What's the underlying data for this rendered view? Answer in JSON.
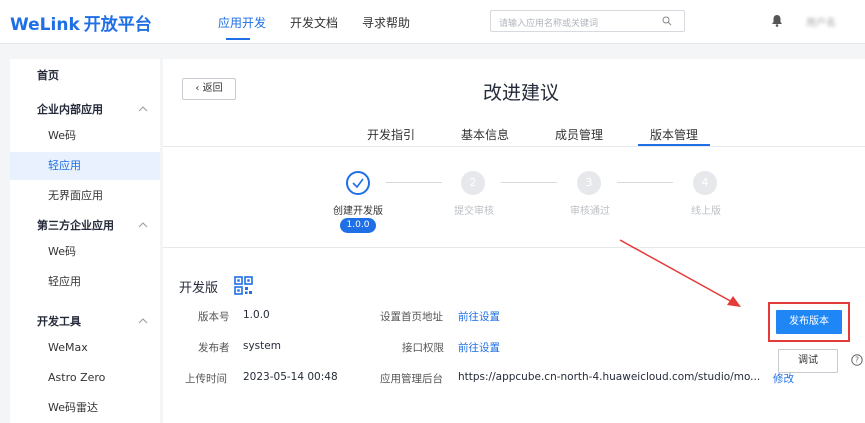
{
  "header": {
    "logo": "WeLink",
    "logo_suffix": "开放平台",
    "nav": [
      "应用开发",
      "开发文档",
      "寻求帮助"
    ],
    "search_placeholder": "请输入应用名称或关键词",
    "user_name": "用户名"
  },
  "sidebar": {
    "items": [
      {
        "label": "首页",
        "type": "group"
      },
      {
        "label": "企业内部应用",
        "type": "group"
      },
      {
        "label": "We码",
        "type": "item"
      },
      {
        "label": "轻应用",
        "type": "item",
        "active": true
      },
      {
        "label": "无界面应用",
        "type": "item"
      },
      {
        "label": "第三方企业应用",
        "type": "group"
      },
      {
        "label": "We码",
        "type": "item"
      },
      {
        "label": "轻应用",
        "type": "item"
      },
      {
        "label": "开发工具",
        "type": "group"
      },
      {
        "label": "WeMax",
        "type": "item"
      },
      {
        "label": "Astro Zero",
        "type": "item"
      },
      {
        "label": "We码雷达",
        "type": "item"
      }
    ]
  },
  "main": {
    "back_label": "返回",
    "title": "改进建议",
    "tabs": [
      "开发指引",
      "基本信息",
      "成员管理",
      "版本管理"
    ],
    "active_tab": "版本管理",
    "steps": [
      {
        "label": "创建开发版",
        "status": "done"
      },
      {
        "label": "提交审核",
        "number": "2",
        "status": "pending"
      },
      {
        "label": "审核通过",
        "number": "3",
        "status": "pending"
      },
      {
        "label": "线上版",
        "number": "4",
        "status": "pending"
      }
    ],
    "current_version_badge": "1.0.0",
    "section_title": "开发版",
    "info": {
      "version_label": "版本号",
      "version_value": "1.0.0",
      "publisher_label": "发布者",
      "publisher_value": "system",
      "upload_time_label": "上传时间",
      "upload_time_value": "2023-05-14 00:48",
      "homepage_label": "设置首页地址",
      "homepage_link": "前往设置",
      "api_label": "接口权限",
      "api_link": "前往设置",
      "admin_label": "应用管理后台",
      "admin_value": "https://appcube.cn-north-4.huaweicloud.com/studio/mo...",
      "edit_link": "修改"
    },
    "publish_button": "发布版本",
    "debug_button": "调试"
  },
  "colors": {
    "accent": "#1f6fe5",
    "highlight": "#e53a3a"
  }
}
